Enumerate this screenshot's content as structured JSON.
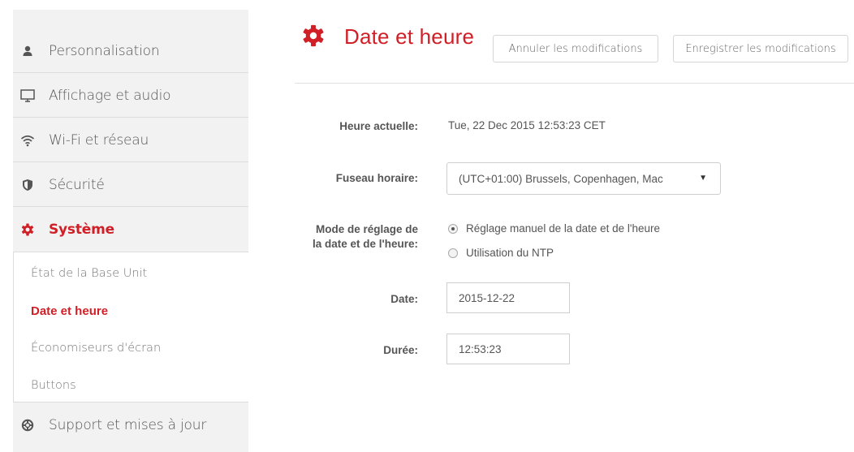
{
  "sidebar": {
    "items": [
      {
        "label": "Personnalisation",
        "icon": "person-icon"
      },
      {
        "label": "Affichage et audio",
        "icon": "monitor-icon"
      },
      {
        "label": "Wi-Fi et réseau",
        "icon": "wifi-icon"
      },
      {
        "label": "Sécurité",
        "icon": "shield-icon"
      },
      {
        "label": "Système",
        "icon": "gear-icon",
        "active": true
      },
      {
        "label": "Support et mises à jour",
        "icon": "lifebuoy-icon"
      }
    ],
    "submenu": [
      {
        "label": "État de la Base Unit"
      },
      {
        "label": "Date et heure",
        "active": true
      },
      {
        "label": "Économiseurs d'écran"
      },
      {
        "label": "Buttons"
      }
    ]
  },
  "header": {
    "title": "Date et heure",
    "icon": "gear-icon",
    "cancel_label": "Annuler les modifications",
    "save_label": "Enregistrer les modifications"
  },
  "form": {
    "current_time": {
      "label": "Heure actuelle:",
      "value": "Tue, 22 Dec 2015 12:53:23 CET"
    },
    "timezone": {
      "label": "Fuseau horaire:",
      "value": "(UTC+01:00) Brussels, Copenhagen, Mac"
    },
    "mode": {
      "label_line1": "Mode de réglage de",
      "label_line2": "la date et de l'heure:",
      "options": [
        {
          "label": "Réglage manuel de la date et de l'heure",
          "checked": true
        },
        {
          "label": "Utilisation du NTP",
          "checked": false
        }
      ]
    },
    "date": {
      "label": "Date:",
      "value": "2015-12-22"
    },
    "duration": {
      "label": "Durée:",
      "value": "12:53:23"
    }
  },
  "colors": {
    "accent": "#d01f26",
    "sidebar_bg": "#f2f2f2",
    "divider": "#e2e2e2"
  }
}
